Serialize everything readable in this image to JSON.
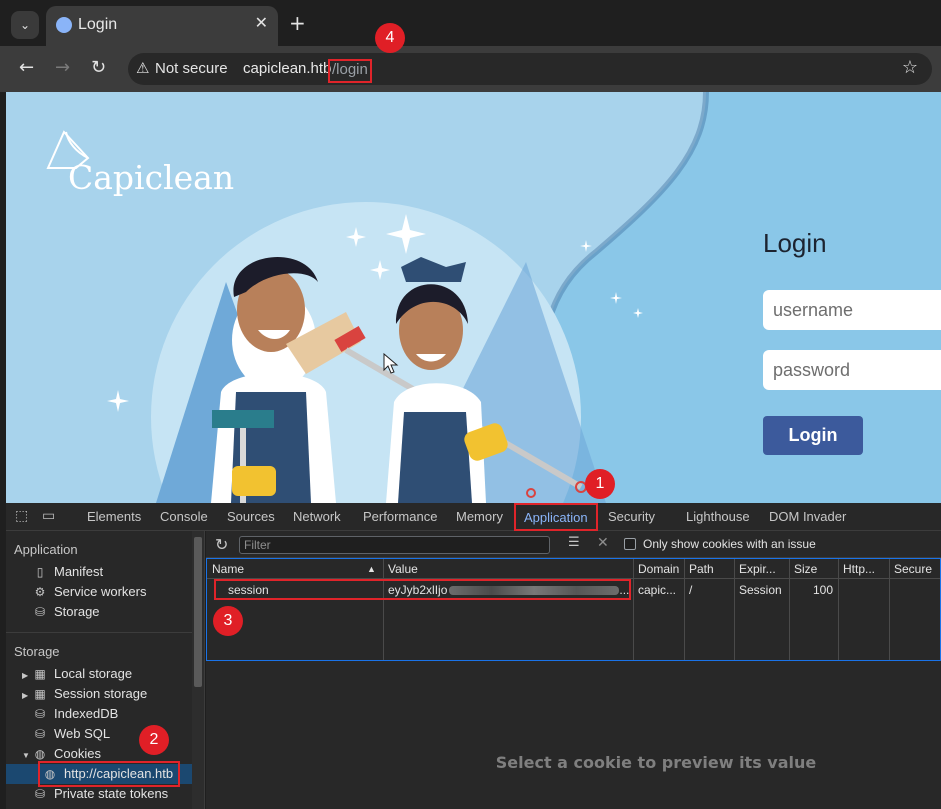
{
  "browser": {
    "tab_title": "Login",
    "tab_close": "✕",
    "new_tab": "+",
    "security_label": "Not secure",
    "url_host": "capiclean.htb",
    "url_path": "/login"
  },
  "page": {
    "brand": "Capiclean",
    "login_title": "Login",
    "username_placeholder": "username",
    "password_placeholder": "password",
    "login_button": "Login",
    "colors": {
      "background": "#a8d3ec",
      "button": "#3c5a9c"
    }
  },
  "devtools": {
    "tabs": [
      "Elements",
      "Console",
      "Sources",
      "Network",
      "Performance",
      "Memory",
      "Application",
      "Security",
      "Lighthouse",
      "DOM Invader"
    ],
    "active_tab": "Application",
    "sidebar": {
      "application_heading": "Application",
      "application_items": [
        "Manifest",
        "Service workers",
        "Storage"
      ],
      "storage_heading": "Storage",
      "storage_items": [
        "Local storage",
        "Session storage",
        "IndexedDB",
        "Web SQL",
        "Cookies"
      ],
      "selected_cookie_origin": "http://capiclean.htb",
      "last_item": "Private state tokens"
    },
    "cookies": {
      "filter_placeholder": "Filter",
      "only_issues_label": "Only show cookies with an issue",
      "columns": [
        "Name",
        "Value",
        "Domain",
        "Path",
        "Expir...",
        "Size",
        "Http...",
        "Secure"
      ],
      "rows": [
        {
          "name": "session",
          "value": "eyJyb2xlIjo",
          "domain": "capic...",
          "path": "/",
          "expires": "Session",
          "size": "100"
        }
      ],
      "preview_text": "Select a cookie to preview its value"
    }
  },
  "annotations": [
    "1",
    "2",
    "3",
    "4"
  ],
  "highlight_color": "#e0242a"
}
